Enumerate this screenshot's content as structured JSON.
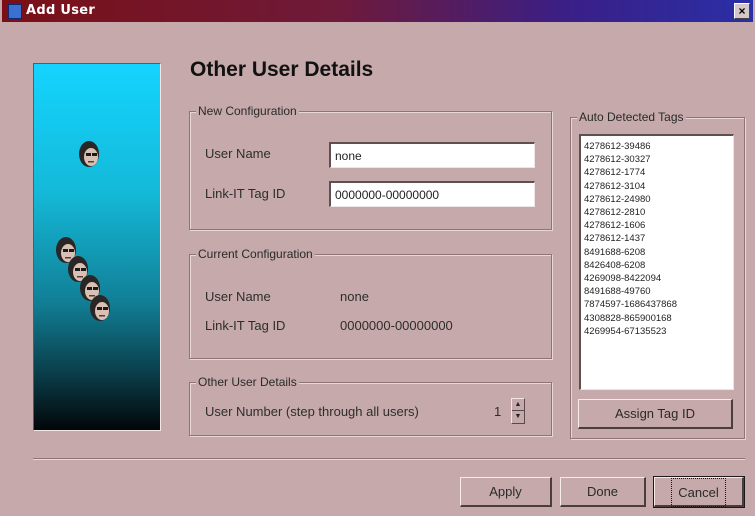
{
  "window": {
    "title": "Add User",
    "close_glyph": "×"
  },
  "page_title": "Other User Details",
  "new_config": {
    "label": "New Configuration",
    "user_name_label": "User Name",
    "user_name_value": "none",
    "tag_id_label": "Link-IT Tag ID",
    "tag_id_value": "0000000-00000000"
  },
  "current_config": {
    "label": "Current Configuration",
    "user_name_label": "User Name",
    "user_name_value": "none",
    "tag_id_label": "Link-IT Tag ID",
    "tag_id_value": "0000000-00000000"
  },
  "other_details": {
    "label": "Other User Details",
    "user_number_label": "User Number (step through all users)",
    "user_number_value": "1"
  },
  "auto_tags": {
    "label": "Auto Detected Tags",
    "items": [
      "4278612-39486",
      "4278612-30327",
      "4278612-1774",
      "4278612-3104",
      "4278612-24980",
      "4278612-2810",
      "4278612-1606",
      "4278612-1437",
      "8491688-6208",
      "8426408-6208",
      "4269098-8422094",
      "8491688-49760",
      "7874597-1686437868",
      "4308828-865900168",
      "4269954-67135523"
    ],
    "assign_button": "Assign Tag ID"
  },
  "buttons": {
    "apply": "Apply",
    "done": "Done",
    "cancel": "Cancel"
  },
  "icons": {
    "app": "app-icon",
    "close": "close-icon",
    "spin_up": "spin-up-icon",
    "spin_down": "spin-down-icon",
    "side_art": "user-heads-illustration"
  },
  "colors": {
    "dialog_bg": "#c6a9aa",
    "title_start": "#7a1016",
    "title_end": "#2a2fa6",
    "panel_top": "#14d4ff",
    "panel_bottom": "#020608"
  }
}
